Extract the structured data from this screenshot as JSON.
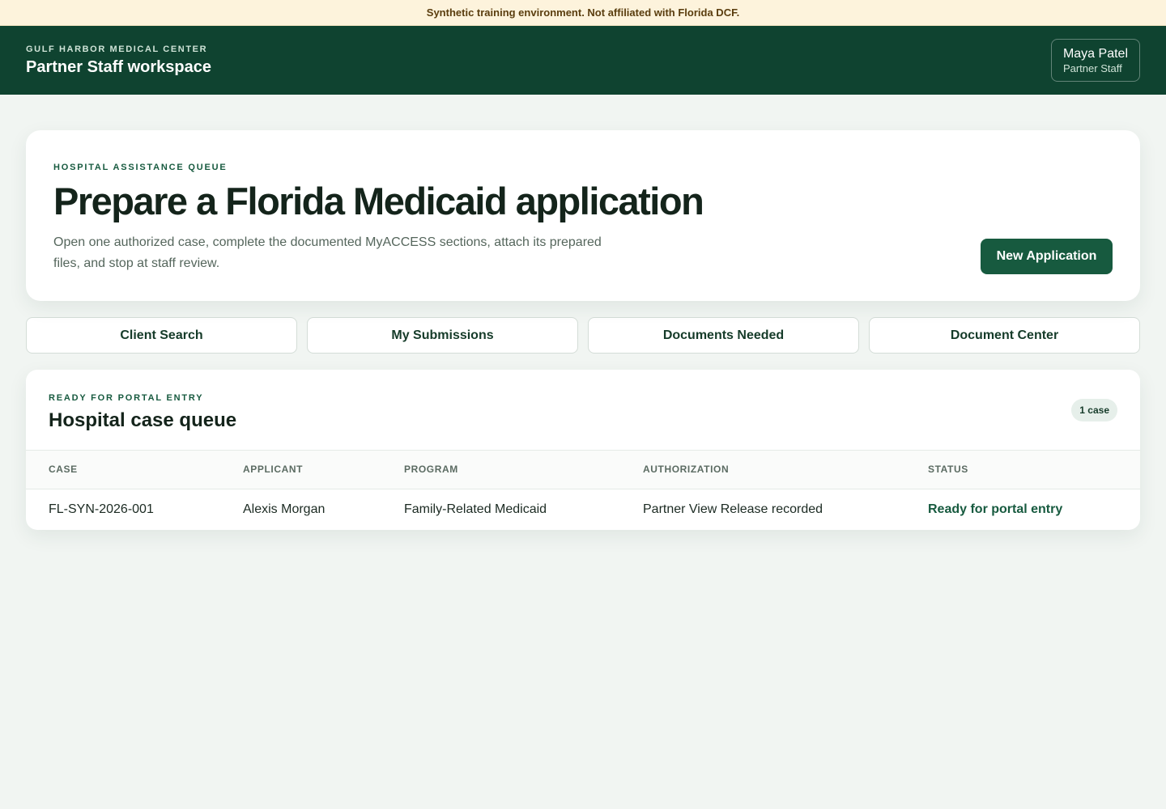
{
  "banner": {
    "text": "Synthetic training environment. Not affiliated with Florida DCF."
  },
  "header": {
    "org": "GULF HARBOR MEDICAL CENTER",
    "workspace": "Partner Staff workspace",
    "user": {
      "name": "Maya Patel",
      "role": "Partner Staff"
    }
  },
  "hero": {
    "eyebrow": "HOSPITAL ASSISTANCE QUEUE",
    "title": "Prepare a Florida Medicaid application",
    "description": "Open one authorized case, complete the documented MyACCESS sections, attach its prepared files, and stop at staff review.",
    "action_label": "New Application"
  },
  "nav": {
    "client_search": "Client Search",
    "my_submissions": "My Submissions",
    "documents_needed": "Documents Needed",
    "document_center": "Document Center"
  },
  "queue": {
    "eyebrow": "READY FOR PORTAL ENTRY",
    "title": "Hospital case queue",
    "count": "1 case",
    "columns": [
      "CASE",
      "APPLICANT",
      "PROGRAM",
      "AUTHORIZATION",
      "STATUS"
    ],
    "rows": [
      {
        "case": "FL-SYN-2026-001",
        "applicant": "Alexis Morgan",
        "program": "Family-Related Medicaid",
        "authorization": "Partner View Release recorded",
        "status": "Ready for portal entry"
      }
    ]
  },
  "colors": {
    "brand_dark": "#0f4330",
    "accent": "#175a3f",
    "banner_bg": "#fdf3dc",
    "page_bg": "#f1f5f2"
  }
}
